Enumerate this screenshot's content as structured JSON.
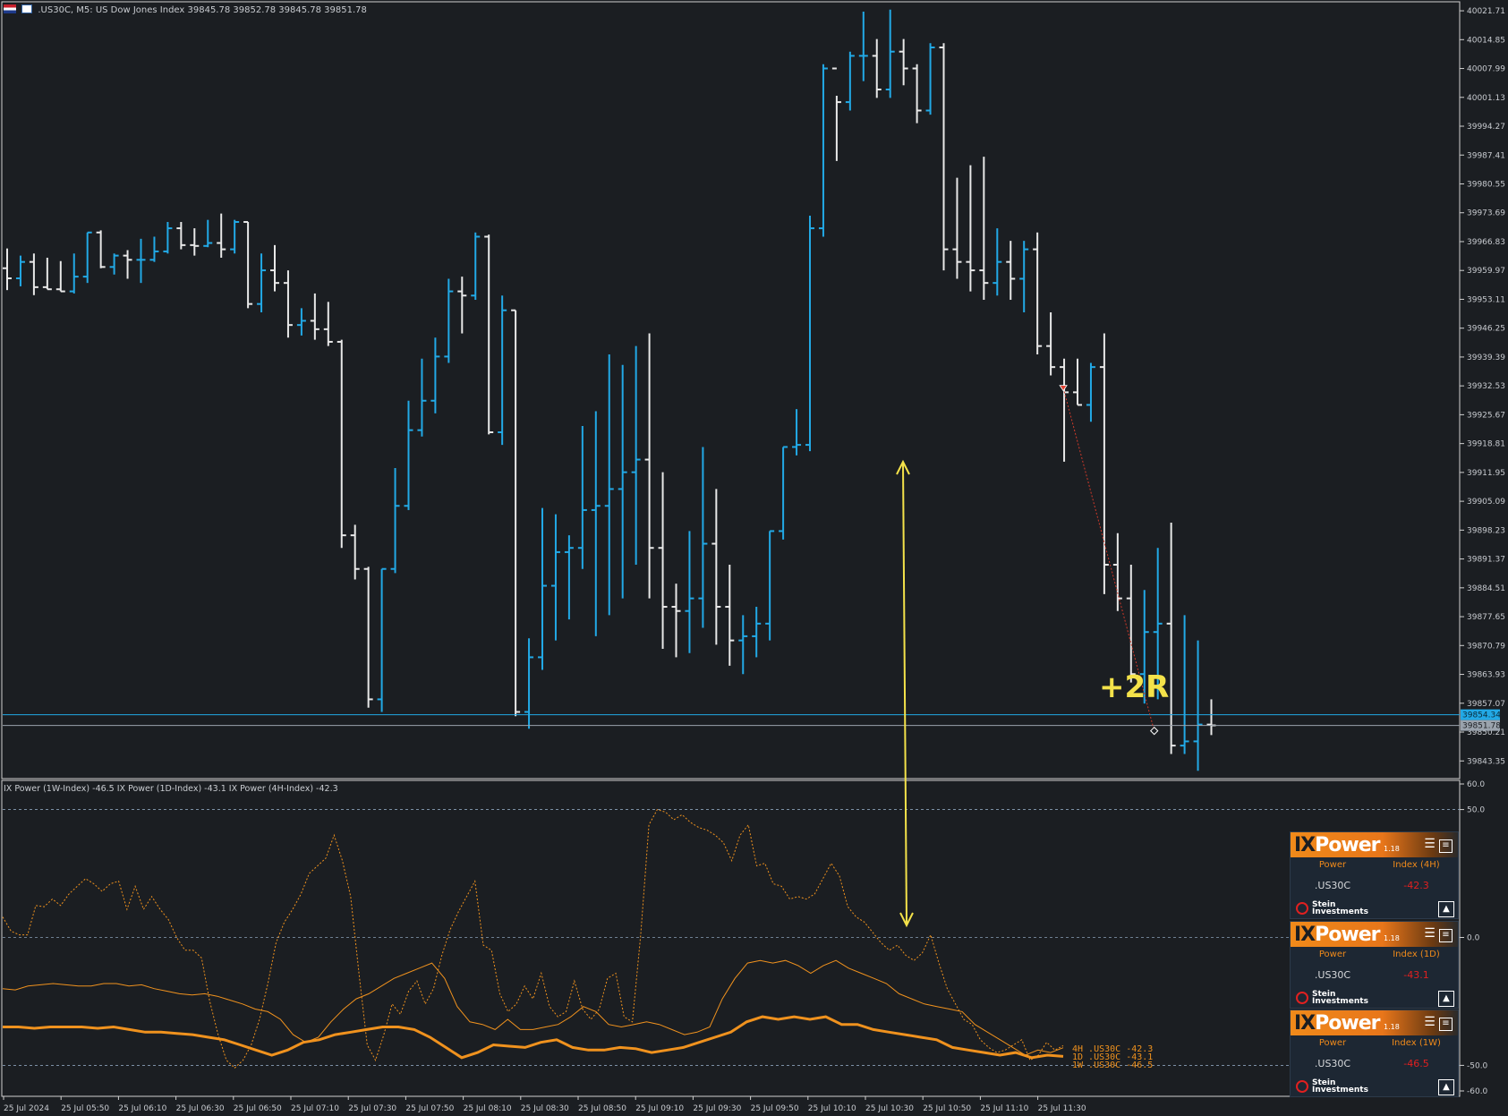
{
  "header": {
    "title": ".US30C, M5:  US Dow Jones Index  39845.78 39852.78 39845.78 39851.78"
  },
  "indicator": {
    "title": "IX Power (1W-Index) -46.5 IX Power (1D-Index) -43.1 IX Power (4H-Index) -42.3",
    "labels": [
      "4H  .US30C -42.3",
      "1D  .US30C -43.1",
      "1W  .US30C -46.5"
    ]
  },
  "annotation": {
    "text": "+2R"
  },
  "price_axis": {
    "ticks": [
      "40021.71",
      "40014.85",
      "40007.99",
      "40001.13",
      "39994.27",
      "39987.41",
      "39980.55",
      "39973.69",
      "39966.83",
      "39959.97",
      "39953.11",
      "39946.25",
      "39939.39",
      "39932.53",
      "39925.67",
      "39918.81",
      "39911.95",
      "39905.09",
      "39898.23",
      "39891.37",
      "39884.51",
      "39877.65",
      "39870.79",
      "39863.93",
      "39857.07",
      "39850.21",
      "39843.35"
    ],
    "current_price_label": "39851.78",
    "level_price_label": "39854.34"
  },
  "indicator_axis": {
    "ticks": [
      "60.0",
      "50.0",
      "0.0",
      "-50.0",
      "-60.0"
    ]
  },
  "time_axis": {
    "ticks": [
      "25 Jul 2024",
      "25 Jul 05:50",
      "25 Jul 06:10",
      "25 Jul 06:30",
      "25 Jul 06:50",
      "25 Jul 07:10",
      "25 Jul 07:30",
      "25 Jul 07:50",
      "25 Jul 08:10",
      "25 Jul 08:30",
      "25 Jul 08:50",
      "25 Jul 09:10",
      "25 Jul 09:30",
      "25 Jul 09:50",
      "25 Jul 10:10",
      "25 Jul 10:30",
      "25 Jul 10:50",
      "25 Jul 11:10",
      "25 Jul 11:30"
    ]
  },
  "colors": {
    "background": "#1b1e22",
    "bull_bar": "#22a9e6",
    "bear_bar": "#e8e8e8",
    "level_line": "#22a9e6",
    "current_line": "#9aa3ad",
    "arrow": "#f4e24a",
    "indicator": "#f0921e"
  },
  "panels": [
    {
      "brand_ix": "IX",
      "brand_rest": "Power",
      "version": "1.18",
      "col1": "Power",
      "col2": "Index (4H)",
      "symbol": ".US30C",
      "value": "-42.3",
      "stein_top": "Stein",
      "stein_bottom": "Investments"
    },
    {
      "brand_ix": "IX",
      "brand_rest": "Power",
      "version": "1.18",
      "col1": "Power",
      "col2": "Index (1D)",
      "symbol": ".US30C",
      "value": "-43.1",
      "stein_top": "Stein",
      "stein_bottom": "Investments"
    },
    {
      "brand_ix": "IX",
      "brand_rest": "Power",
      "version": "1.18",
      "col1": "Power",
      "col2": "Index (1W)",
      "symbol": ".US30C",
      "value": "-46.5",
      "stein_top": "Stein",
      "stein_bottom": "Investments"
    }
  ],
  "chart_data": {
    "type": "ohlc",
    "price_range": [
      39840.0,
      40023.0
    ],
    "level_price": 39854.34,
    "current_price": 39851.78,
    "indicator_range": [
      -60,
      60
    ],
    "bars": [
      [
        39960.5,
        39965.2,
        39955.3,
        39958.1
      ],
      [
        39958.1,
        39963.5,
        39956.2,
        39962.0
      ],
      [
        39962.0,
        39964.0,
        39954.1,
        39956.0
      ],
      [
        39956.0,
        39963.0,
        39955.5,
        39955.5
      ],
      [
        39955.5,
        39962.2,
        39955.0,
        39955.0
      ],
      [
        39955.0,
        39964.0,
        39954.5,
        39958.5
      ],
      [
        39958.5,
        39969.0,
        39957.0,
        39969.0
      ],
      [
        39969.0,
        39969.5,
        39960.5,
        39960.8
      ],
      [
        39960.8,
        39964.0,
        39959.0,
        39963.5
      ],
      [
        39963.5,
        39964.8,
        39958.0,
        39962.5
      ],
      [
        39962.5,
        39967.5,
        39957.0,
        39962.5
      ],
      [
        39962.5,
        39968.0,
        39962.0,
        39964.5
      ],
      [
        39964.5,
        39971.5,
        39964.0,
        39970.0
      ],
      [
        39970.0,
        39971.5,
        39965.0,
        39966.0
      ],
      [
        39966.0,
        39970.0,
        39963.5,
        39965.8
      ],
      [
        39965.8,
        39972.0,
        39965.5,
        39966.5
      ],
      [
        39966.5,
        39973.5,
        39963.0,
        39965.0
      ],
      [
        39965.0,
        39972.0,
        39964.0,
        39971.5
      ],
      [
        39971.5,
        39971.5,
        39951.0,
        39952.0
      ],
      [
        39952.0,
        39964.0,
        39950.0,
        39960.0
      ],
      [
        39960.0,
        39966.0,
        39955.0,
        39957.0
      ],
      [
        39957.0,
        39960.0,
        39944.0,
        39947.0
      ],
      [
        39947.0,
        39951.0,
        39944.5,
        39948.0
      ],
      [
        39948.0,
        39954.5,
        39943.5,
        39946.0
      ],
      [
        39946.0,
        39952.5,
        39942.0,
        39943.0
      ],
      [
        39943.0,
        39943.5,
        39894.0,
        39897.0
      ],
      [
        39897.0,
        39899.5,
        39886.5,
        39889.0
      ],
      [
        39889.0,
        39889.5,
        39856.0,
        39858.0
      ],
      [
        39858.0,
        39889.0,
        39855.0,
        39889.0
      ],
      [
        39889.0,
        39913.0,
        39888.0,
        39904.0
      ],
      [
        39904.0,
        39929.0,
        39903.0,
        39922.0
      ],
      [
        39922.0,
        39939.0,
        39920.5,
        39929.0
      ],
      [
        39929.0,
        39944.0,
        39926.0,
        39939.5
      ],
      [
        39939.5,
        39958.0,
        39938.0,
        39955.0
      ],
      [
        39955.0,
        39958.5,
        39945.0,
        39954.0
      ],
      [
        39954.0,
        39969.0,
        39953.0,
        39968.0
      ],
      [
        39968.0,
        39968.5,
        39921.0,
        39921.5
      ],
      [
        39921.5,
        39954.0,
        39918.5,
        39950.5
      ],
      [
        39950.5,
        39950.5,
        39854.0,
        39855.0
      ],
      [
        39855.0,
        39872.5,
        39851.0,
        39868.0
      ],
      [
        39868.0,
        39903.5,
        39865.0,
        39885.0
      ],
      [
        39885.0,
        39902.0,
        39872.0,
        39893.0
      ],
      [
        39893.0,
        39897.0,
        39877.0,
        39894.0
      ],
      [
        39894.0,
        39923.0,
        39889.0,
        39903.0
      ],
      [
        39903.0,
        39926.5,
        39873.0,
        39904.0
      ],
      [
        39904.0,
        39940.0,
        39878.0,
        39908.0
      ],
      [
        39908.0,
        39937.5,
        39882.0,
        39912.0
      ],
      [
        39912.0,
        39942.0,
        39890.0,
        39915.0
      ],
      [
        39915.0,
        39945.0,
        39882.0,
        39894.0
      ],
      [
        39894.0,
        39912.0,
        39870.0,
        39880.0
      ],
      [
        39880.0,
        39885.5,
        39868.0,
        39879.0
      ],
      [
        39879.0,
        39898.0,
        39869.0,
        39882.0
      ],
      [
        39882.0,
        39918.0,
        39875.0,
        39895.0
      ],
      [
        39895.0,
        39908.0,
        39871.0,
        39880.0
      ],
      [
        39880.0,
        39890.0,
        39866.0,
        39872.0
      ],
      [
        39872.0,
        39878.0,
        39864.0,
        39873.0
      ],
      [
        39873.0,
        39880.0,
        39868.0,
        39876.0
      ],
      [
        39876.0,
        39898.0,
        39872.0,
        39898.0
      ],
      [
        39898.0,
        39918.0,
        39896.0,
        39918.0
      ],
      [
        39918.0,
        39927.0,
        39916.0,
        39918.5
      ],
      [
        39918.5,
        39973.0,
        39917.0,
        39970.0
      ],
      [
        39970.0,
        40009.0,
        39968.0,
        40008.0
      ],
      [
        40008.0,
        40001.5,
        39986.0,
        40000.0
      ],
      [
        40000.0,
        40012.0,
        39998.0,
        40011.0
      ],
      [
        40011.0,
        40021.5,
        40005.0,
        40011.0
      ],
      [
        40011.0,
        40015.0,
        40001.0,
        40003.0
      ],
      [
        40003.0,
        40022.0,
        40001.0,
        40012.0
      ],
      [
        40012.0,
        40015.0,
        40004.0,
        40008.0
      ],
      [
        40008.0,
        40009.0,
        39995.0,
        39998.0
      ],
      [
        39998.0,
        40014.0,
        39997.0,
        40013.0
      ],
      [
        40013.0,
        40014.0,
        39960.0,
        39965.0
      ],
      [
        39965.0,
        39982.0,
        39958.0,
        39962.0
      ],
      [
        39962.0,
        39985.0,
        39955.0,
        39960.0
      ],
      [
        39960.0,
        39987.0,
        39953.0,
        39957.0
      ],
      [
        39957.0,
        39970.0,
        39954.0,
        39962.0
      ],
      [
        39962.0,
        39967.0,
        39953.0,
        39958.0
      ],
      [
        39958.0,
        39967.0,
        39950.0,
        39965.0
      ],
      [
        39965.0,
        39969.0,
        39940.0,
        39942.0
      ],
      [
        39942.0,
        39950.0,
        39935.0,
        39937.0
      ],
      [
        39937.0,
        39939.0,
        39914.5,
        39931.0
      ],
      [
        39931.0,
        39939.0,
        39928.0,
        39928.0
      ],
      [
        39928.0,
        39938.0,
        39924.0,
        39937.0
      ],
      [
        39937.0,
        39945.0,
        39883.0,
        39890.0
      ],
      [
        39890.0,
        39897.5,
        39879.0,
        39882.0
      ],
      [
        39882.0,
        39890.0,
        39862.0,
        39864.0
      ],
      [
        39864.0,
        39884.0,
        39857.0,
        39874.0
      ],
      [
        39874.0,
        39894.0,
        39858.0,
        39876.0
      ],
      [
        39876.0,
        39900.0,
        39845.0,
        39847.0
      ],
      [
        39847.0,
        39878.0,
        39845.0,
        39848.0
      ],
      [
        39848.0,
        39872.0,
        39841.0,
        39852.0
      ],
      [
        39852.0,
        39858.0,
        39849.5,
        39851.8
      ]
    ],
    "indicator": {
      "h4": [
        8.0,
        2.5,
        1.0,
        1.0,
        12.5,
        12.0,
        15.0,
        12.5,
        17.0,
        20.0,
        23.0,
        21.0,
        18.0,
        21.0,
        22.0,
        11.0,
        20.0,
        11.0,
        16.0,
        11.0,
        7.0,
        0.0,
        -5.0,
        -5.0,
        -8.0,
        -25.0,
        -38.0,
        -48.0,
        -51.0,
        -48.0,
        -42.0,
        -32.0,
        -18.0,
        -2.0,
        6.0,
        11.0,
        17.0,
        25.0,
        28.0,
        31.0,
        40.0,
        30.0,
        16.0,
        -14.0,
        -42.0,
        -48.0,
        -38.0,
        -26.0,
        -30.0,
        -21.0,
        -17.0,
        -26.0,
        -20.0,
        -7.0,
        3.0,
        10.0,
        16.0,
        22.0,
        -3.0,
        -5.0,
        -22.0,
        -29.0,
        -26.0,
        -19.0,
        -24.0,
        -14.0,
        -27.0,
        -31.0,
        -29.0,
        -17.0,
        -28.0,
        -32.0,
        -28.0,
        -16.0,
        -14.0,
        -31.0,
        -33.0,
        1.0,
        44.0,
        50.0,
        49.0,
        46.0,
        48.0,
        45.0,
        43.0,
        42.0,
        40.0,
        37.0,
        30.0,
        40.0,
        44.0,
        28.0,
        29.0,
        21.0,
        20.0,
        15.0,
        16.0,
        15.0,
        17.0,
        23.0,
        29.0,
        24.0,
        12.0,
        8.0,
        6.0,
        2.0,
        -2.0,
        -5.0,
        -3.0,
        -7.0,
        -9.0,
        -6.0,
        1.0,
        -10.0,
        -20.0,
        -26.0,
        -32.0,
        -34.0,
        -40.0,
        -43.0,
        -45.0,
        -44.0,
        -42.0,
        -40.0,
        -48.0,
        -46.0,
        -41.0,
        -44.0,
        -42.3
      ],
      "d1": [
        -20.0,
        -20.5,
        -19.0,
        -18.5,
        -18.0,
        -18.5,
        -19.0,
        -19.0,
        -18.0,
        -18.0,
        -19.0,
        -18.5,
        -20.0,
        -21.0,
        -22.0,
        -22.5,
        -22.0,
        -23.0,
        -24.5,
        -26.0,
        -28.0,
        -29.0,
        -32.0,
        -38.0,
        -41.0,
        -39.0,
        -33.0,
        -28.0,
        -24.0,
        -22.0,
        -19.0,
        -16.0,
        -14.0,
        -12.0,
        -10.0,
        -16.0,
        -27.0,
        -33.0,
        -34.0,
        -36.0,
        -32.0,
        -36.0,
        -36.0,
        -35.0,
        -34.0,
        -31.0,
        -27.0,
        -29.0,
        -34.0,
        -35.0,
        -34.0,
        -33.0,
        -34.0,
        -36.0,
        -38.0,
        -37.0,
        -35.0,
        -24.0,
        -16.0,
        -10.0,
        -9.0,
        -10.0,
        -9.0,
        -11.0,
        -14.0,
        -11.0,
        -9.0,
        -12.0,
        -14.0,
        -16.0,
        -18.0,
        -22.0,
        -24.0,
        -26.0,
        -27.0,
        -28.0,
        -29.0,
        -34.0,
        -37.0,
        -40.0,
        -43.0,
        -46.0,
        -44.0,
        -45.0,
        -43.1
      ],
      "w1": [
        -35.0,
        -35.0,
        -35.5,
        -35.0,
        -35.0,
        -35.0,
        -35.5,
        -35.0,
        -36.0,
        -37.0,
        -37.0,
        -37.5,
        -38.0,
        -39.0,
        -40.0,
        -42.0,
        -44.0,
        -46.0,
        -44.0,
        -41.0,
        -40.0,
        -38.0,
        -37.0,
        -36.0,
        -35.0,
        -35.0,
        -36.0,
        -39.0,
        -43.0,
        -47.0,
        -45.0,
        -42.0,
        -42.5,
        -43.0,
        -41.0,
        -40.0,
        -43.0,
        -44.0,
        -44.0,
        -43.0,
        -43.5,
        -45.0,
        -44.0,
        -43.0,
        -41.0,
        -39.0,
        -37.0,
        -33.0,
        -31.0,
        -32.0,
        -31.0,
        -32.0,
        -31.0,
        -34.0,
        -34.0,
        -36.0,
        -37.0,
        -38.0,
        -39.0,
        -40.0,
        -43.0,
        -44.0,
        -45.0,
        -46.0,
        -45.0,
        -47.0,
        -46.0,
        -46.5
      ]
    }
  }
}
